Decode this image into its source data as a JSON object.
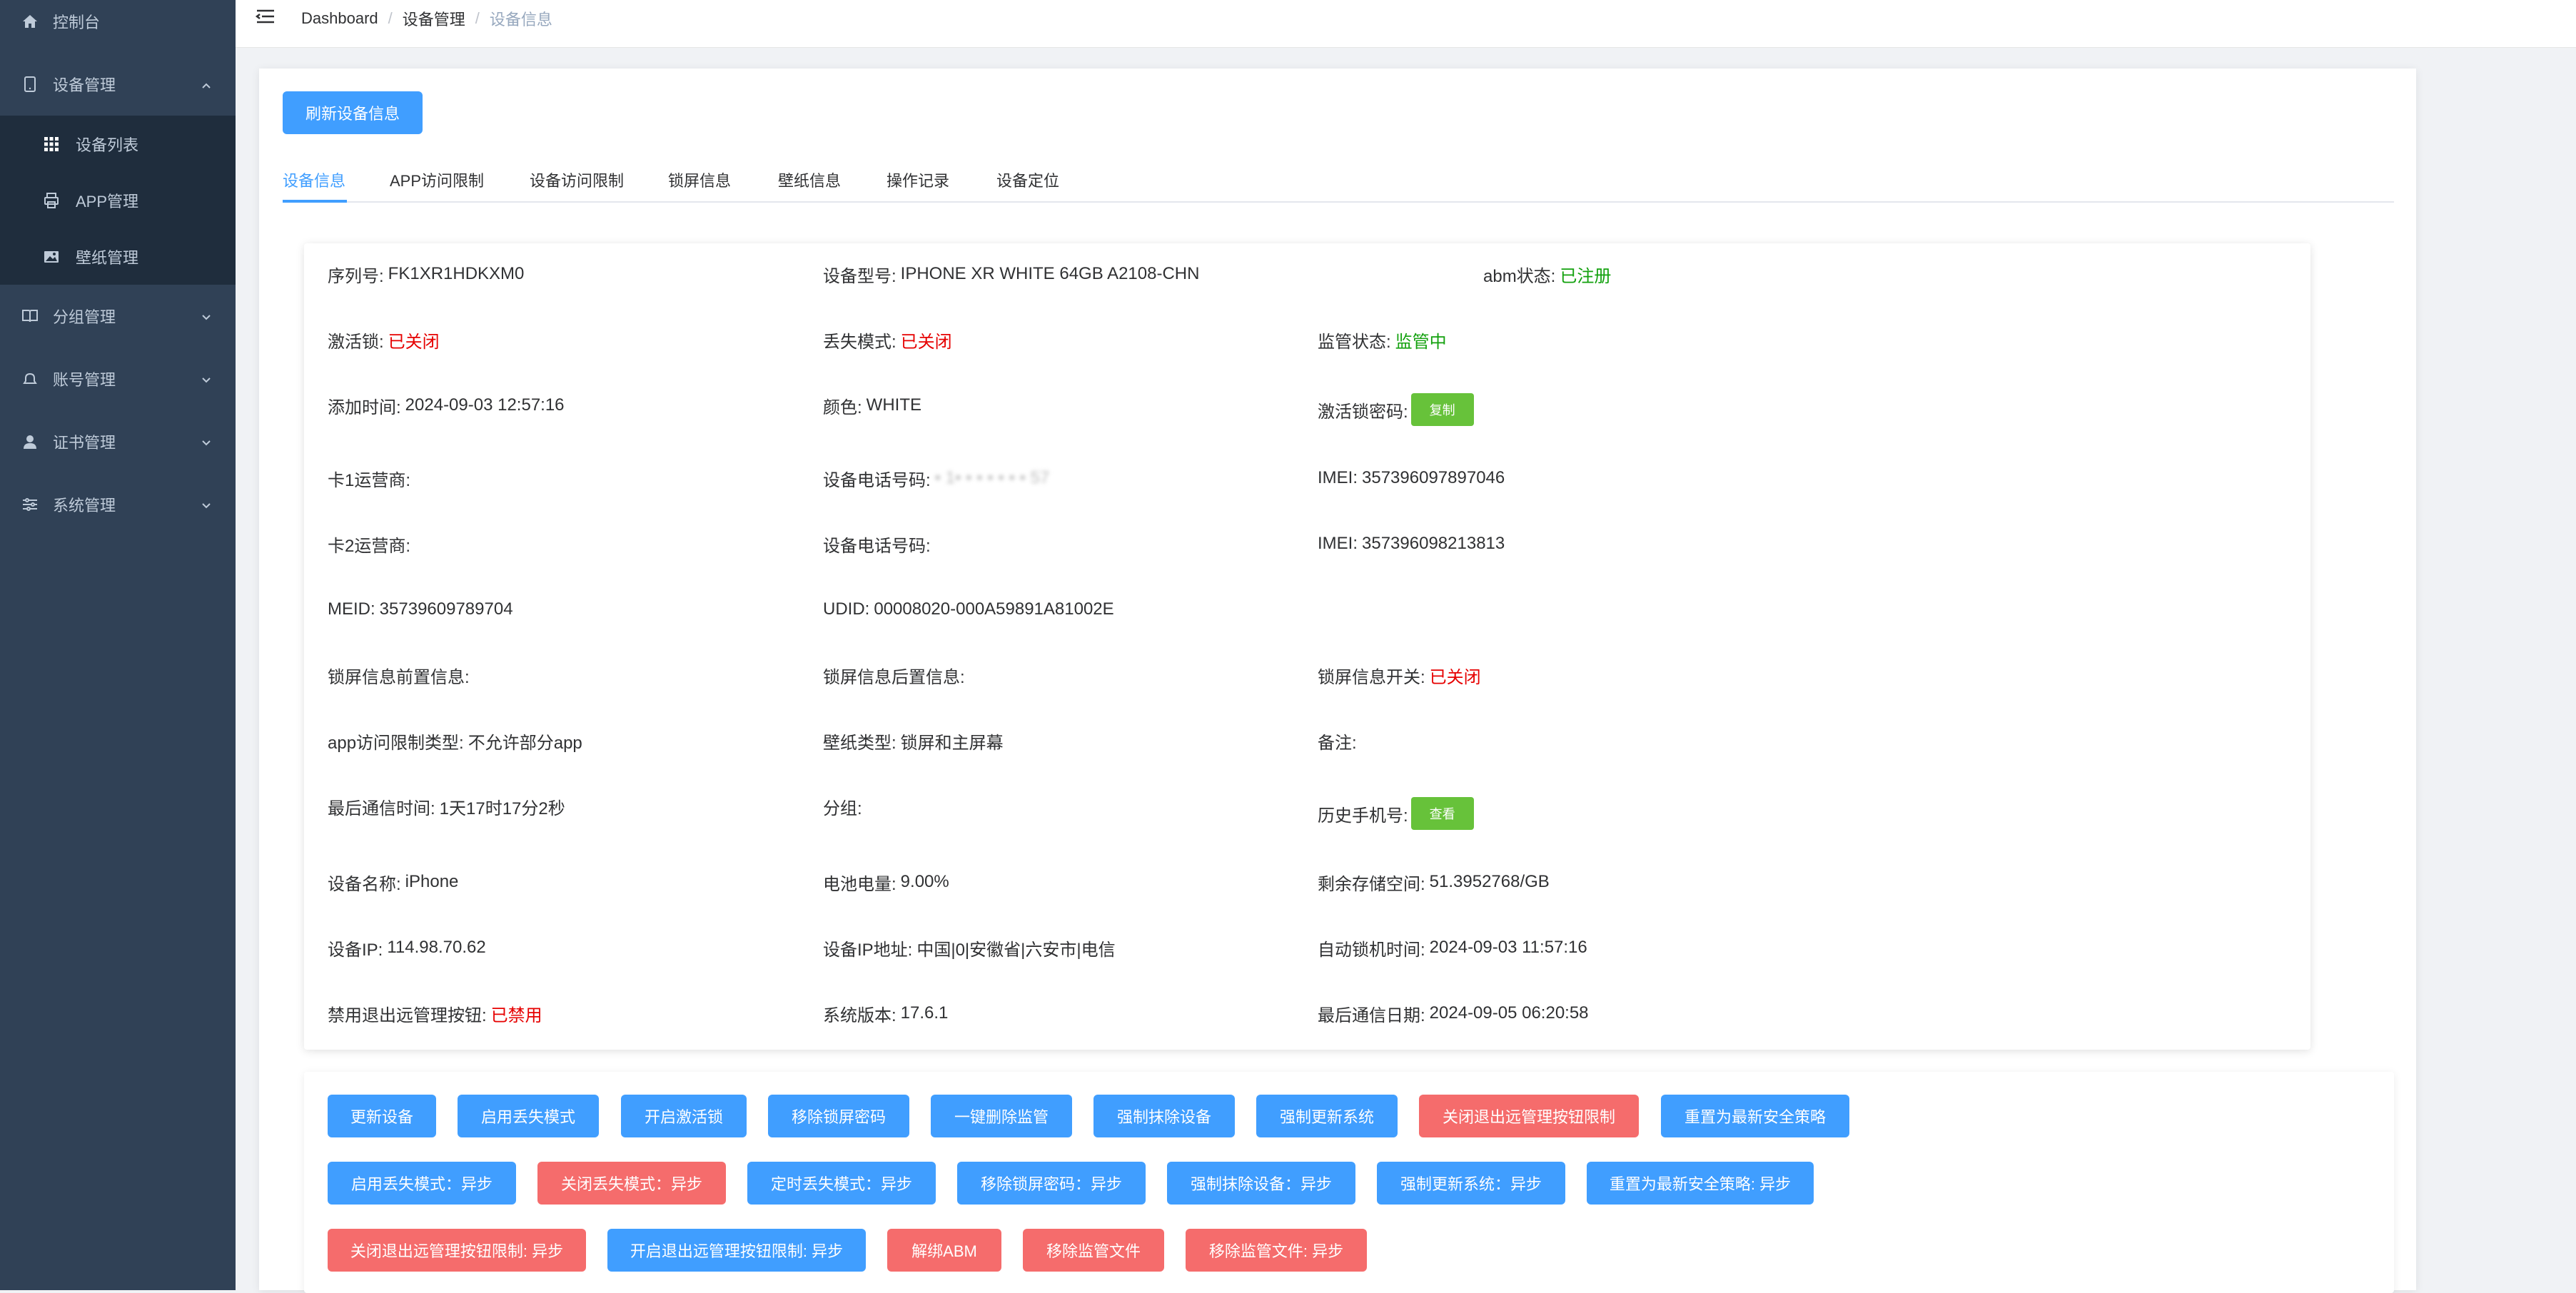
{
  "sidebar": {
    "items": [
      {
        "label": "控制台",
        "icon": "home-icon"
      },
      {
        "label": "设备管理",
        "icon": "tablet-icon"
      },
      {
        "label": "分组管理",
        "icon": "book-icon"
      },
      {
        "label": "账号管理",
        "icon": "bell-icon"
      },
      {
        "label": "证书管理",
        "icon": "user-icon"
      },
      {
        "label": "系统管理",
        "icon": "sliders-icon"
      }
    ],
    "submenu": [
      {
        "label": "设备列表",
        "icon": "grid-icon"
      },
      {
        "label": "APP管理",
        "icon": "printer-icon"
      },
      {
        "label": "壁纸管理",
        "icon": "image-icon"
      }
    ]
  },
  "breadcrumb": {
    "home": "Dashboard",
    "section": "设备管理",
    "current": "设备信息",
    "sep": "/"
  },
  "refresh_button": "刷新设备信息",
  "tabs": [
    "设备信息",
    "APP访问限制",
    "设备访问限制",
    "锁屏信息",
    "壁纸信息",
    "操作记录",
    "设备定位"
  ],
  "device": {
    "serial_label": "序列号:",
    "serial": "FK1XR1HDKXM0",
    "model_label": "设备型号:",
    "model": "IPHONE XR WHITE 64GB A2108-CHN",
    "abm_label": "abm状态:",
    "abm": "已注册",
    "activation_lock_label": "激活锁:",
    "activation_lock": "已关闭",
    "lost_mode_label": "丢失模式:",
    "lost_mode": "已关闭",
    "supervision_label": "监管状态:",
    "supervision": "监管中",
    "added_label": "添加时间:",
    "added": "2024-09-03 12:57:16",
    "color_label": "颜色:",
    "color": "WHITE",
    "lock_pwd_label": "激活锁密码:",
    "copy_button": "复制",
    "carrier1_label": "卡1运营商:",
    "phone1_label": "设备电话号码:",
    "phone1_masked": "• 1• • • • • • • 57",
    "imei1_label": "IMEI:",
    "imei1": "357396097897046",
    "carrier2_label": "卡2运营商:",
    "phone2_label": "设备电话号码:",
    "imei2_label": "IMEI:",
    "imei2": "357396098213813",
    "meid_label": "MEID:",
    "meid": "35739609789704",
    "udid_label": "UDID:",
    "udid": "00008020-000A59891A81002E",
    "lock_pre_label": "锁屏信息前置信息:",
    "lock_post_label": "锁屏信息后置信息:",
    "lock_switch_label": "锁屏信息开关:",
    "lock_switch": "已关闭",
    "app_limit_label": "app访问限制类型:",
    "app_limit": "不允许部分app",
    "wallpaper_label": "壁纸类型:",
    "wallpaper": "锁屏和主屏幕",
    "note_label": "备注:",
    "last_comm_label": "最后通信时间:",
    "last_comm": "1天17时17分2秒",
    "group_label": "分组:",
    "history_phone_label": "历史手机号:",
    "view_button": "查看",
    "name_label": "设备名称:",
    "name": "iPhone",
    "battery_label": "电池电量:",
    "battery": "9.00%",
    "storage_label": "剩余存储空间:",
    "storage": "51.3952768/GB",
    "ip_label": "设备IP:",
    "ip": "114.98.70.62",
    "ip_addr_label": "设备IP地址:",
    "ip_addr": "中国|0|安徽省|六安市|电信",
    "autolock_label": "自动锁机时间:",
    "autolock": "2024-09-03 11:57:16",
    "disable_exit_label": "禁用退出远管理按钮:",
    "disable_exit": "已禁用",
    "os_label": "系统版本:",
    "os": "17.6.1",
    "last_date_label": "最后通信日期:",
    "last_date": "2024-09-05 06:20:58"
  },
  "actions": {
    "row1": [
      {
        "label": "更新设备",
        "type": "primary"
      },
      {
        "label": "启用丢失模式",
        "type": "primary"
      },
      {
        "label": "开启激活锁",
        "type": "primary"
      },
      {
        "label": "移除锁屏密码",
        "type": "primary"
      },
      {
        "label": "一键删除监管",
        "type": "primary"
      },
      {
        "label": "强制抹除设备",
        "type": "primary"
      },
      {
        "label": "强制更新系统",
        "type": "primary"
      },
      {
        "label": "关闭退出远管理按钮限制",
        "type": "danger"
      },
      {
        "label": "重置为最新安全策略",
        "type": "primary"
      }
    ],
    "row2": [
      {
        "label": "启用丢失模式：异步",
        "type": "primary"
      },
      {
        "label": "关闭丢失模式：异步",
        "type": "danger"
      },
      {
        "label": "定时丢失模式：异步",
        "type": "primary"
      },
      {
        "label": "移除锁屏密码：异步",
        "type": "primary"
      },
      {
        "label": "强制抹除设备：异步",
        "type": "primary"
      },
      {
        "label": "强制更新系统：异步",
        "type": "primary"
      },
      {
        "label": "重置为最新安全策略: 异步",
        "type": "primary"
      }
    ],
    "row3": [
      {
        "label": "关闭退出远管理按钮限制: 异步",
        "type": "danger"
      },
      {
        "label": "开启退出远管理按钮限制: 异步",
        "type": "primary"
      },
      {
        "label": "解绑ABM",
        "type": "danger"
      },
      {
        "label": "移除监管文件",
        "type": "danger"
      },
      {
        "label": "移除监管文件: 异步",
        "type": "danger"
      }
    ]
  },
  "colors": {
    "sidebar_bg": "#304156",
    "primary": "#409eff",
    "danger": "#f56c6c",
    "success": "#67c23a"
  }
}
